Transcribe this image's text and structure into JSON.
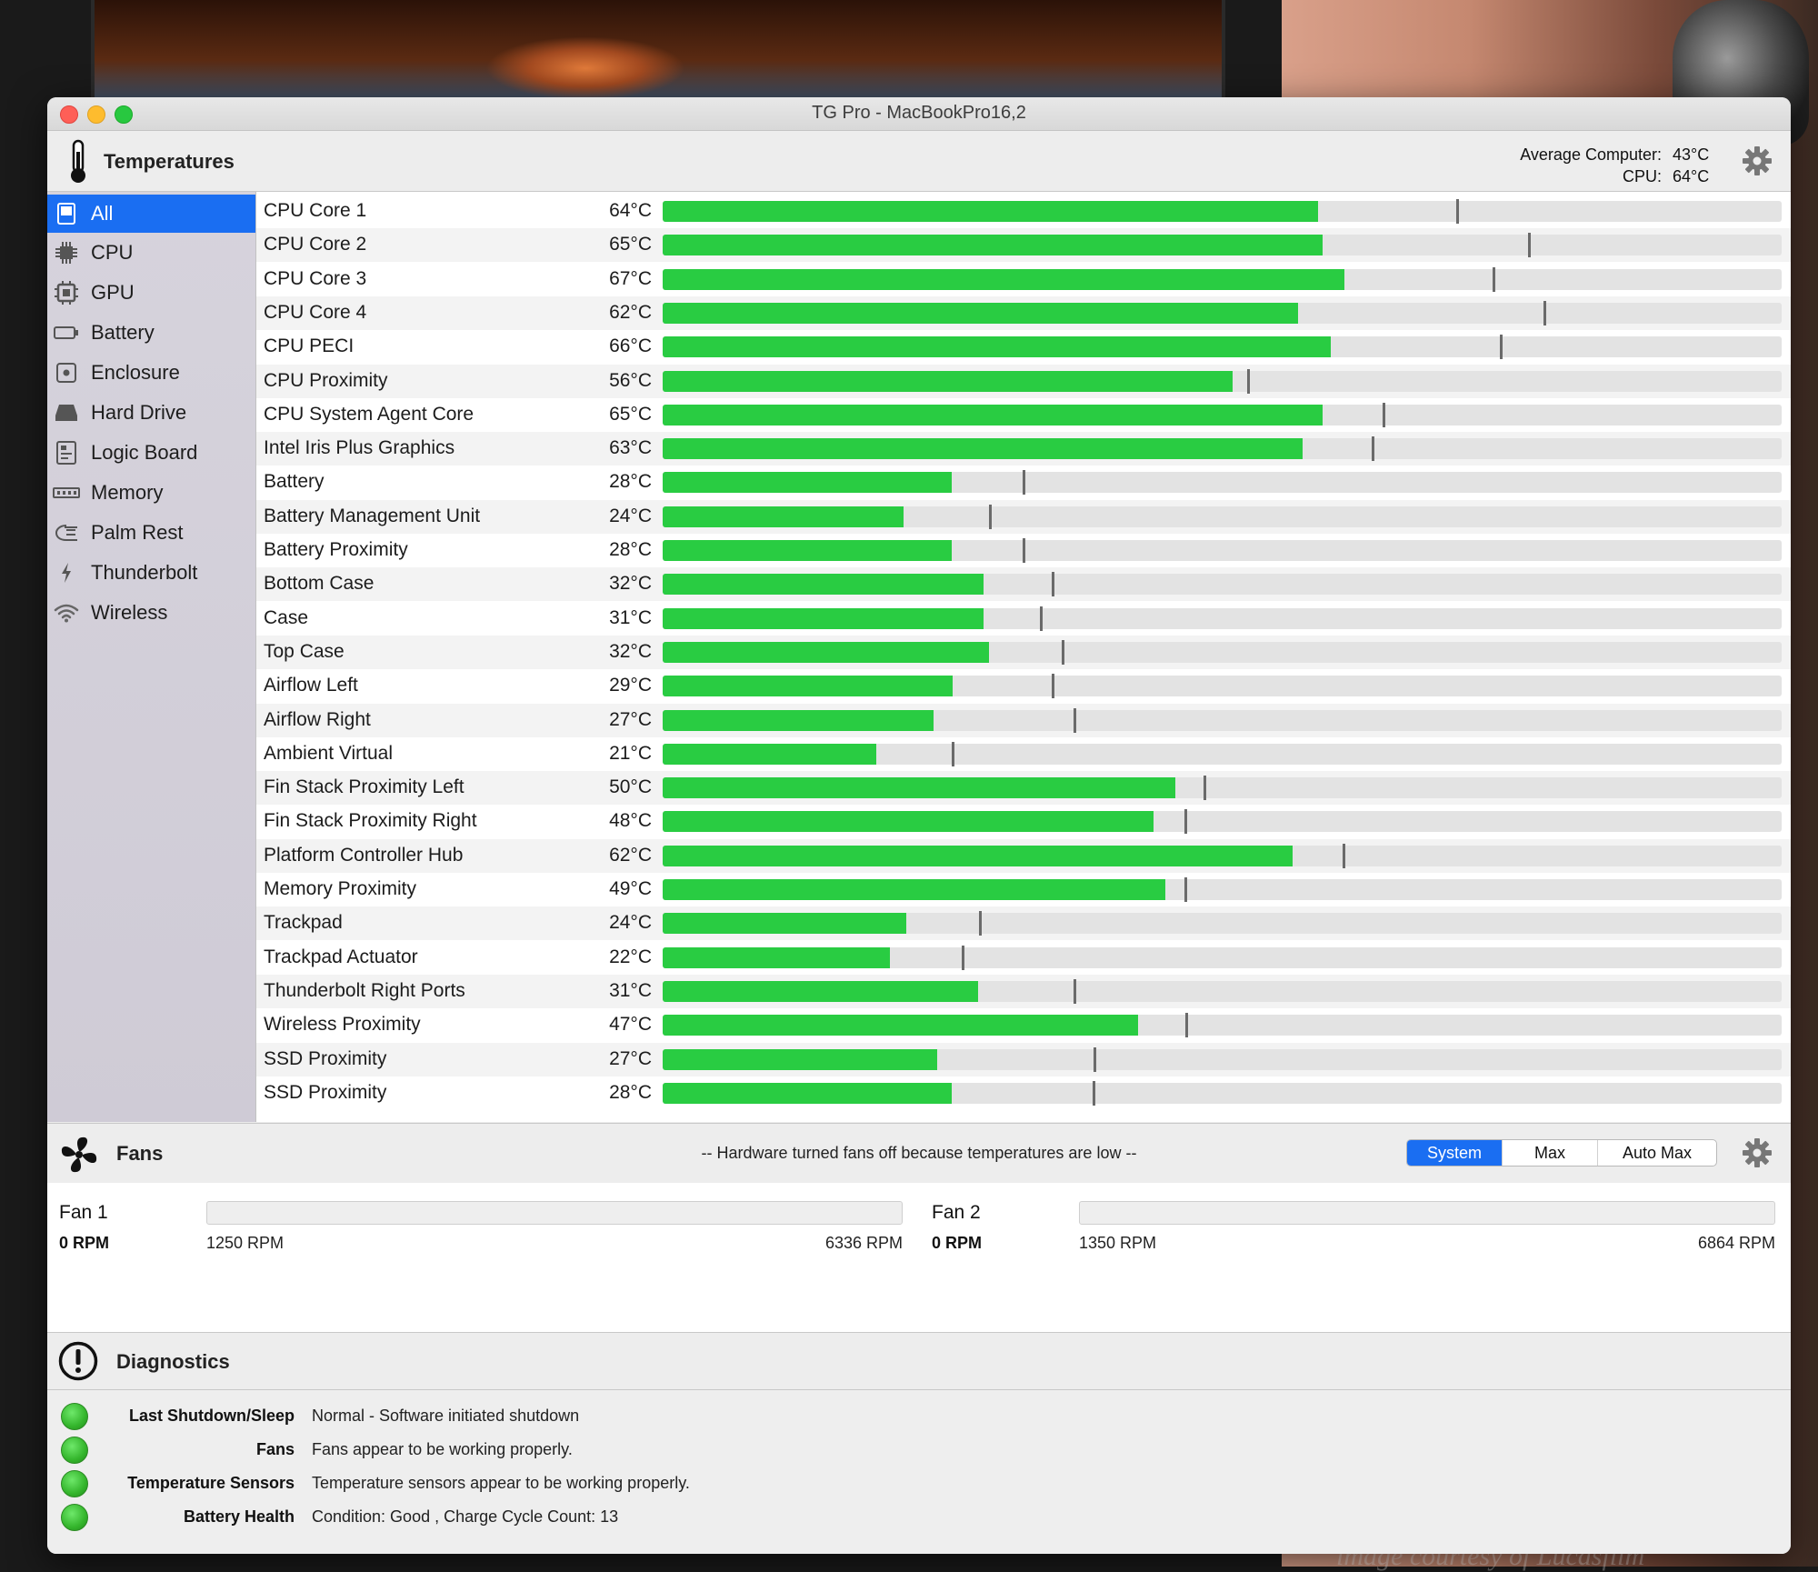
{
  "window": {
    "title": "TG Pro - MacBookPro16,2"
  },
  "temperatures": {
    "title": "Temperatures",
    "average_label": "Average Computer:",
    "average_value": "43°C",
    "cpu_label": "CPU:",
    "cpu_value": "64°C"
  },
  "sidebar": {
    "items": [
      {
        "label": "All",
        "icon": "all-icon",
        "active": true
      },
      {
        "label": "CPU",
        "icon": "cpu-icon"
      },
      {
        "label": "GPU",
        "icon": "gpu-icon"
      },
      {
        "label": "Battery",
        "icon": "battery-icon"
      },
      {
        "label": "Enclosure",
        "icon": "enclosure-icon"
      },
      {
        "label": "Hard Drive",
        "icon": "hard-drive-icon"
      },
      {
        "label": "Logic Board",
        "icon": "logic-board-icon"
      },
      {
        "label": "Memory",
        "icon": "memory-icon"
      },
      {
        "label": "Palm Rest",
        "icon": "palm-rest-icon"
      },
      {
        "label": "Thunderbolt",
        "icon": "thunderbolt-icon"
      },
      {
        "label": "Wireless",
        "icon": "wireless-icon"
      }
    ]
  },
  "sensors": [
    {
      "name": "CPU Core 1",
      "value": "64°C",
      "level": 0.586,
      "max_level": 0.709
    },
    {
      "name": "CPU Core 2",
      "value": "65°C",
      "level": 0.59,
      "max_level": 0.773
    },
    {
      "name": "CPU Core 3",
      "value": "67°C",
      "level": 0.609,
      "max_level": 0.742
    },
    {
      "name": "CPU Core 4",
      "value": "62°C",
      "level": 0.568,
      "max_level": 0.787
    },
    {
      "name": "CPU PECI",
      "value": "66°C",
      "level": 0.597,
      "max_level": 0.748
    },
    {
      "name": "CPU Proximity",
      "value": "56°C",
      "level": 0.509,
      "max_level": 0.522
    },
    {
      "name": "CPU System Agent Core",
      "value": "65°C",
      "level": 0.59,
      "max_level": 0.643
    },
    {
      "name": "Intel Iris Plus Graphics",
      "value": "63°C",
      "level": 0.572,
      "max_level": 0.634
    },
    {
      "name": "Battery",
      "value": "28°C",
      "level": 0.258,
      "max_level": 0.322
    },
    {
      "name": "Battery Management Unit",
      "value": "24°C",
      "level": 0.215,
      "max_level": 0.292
    },
    {
      "name": "Battery Proximity",
      "value": "28°C",
      "level": 0.258,
      "max_level": 0.322
    },
    {
      "name": "Bottom Case",
      "value": "32°C",
      "level": 0.287,
      "max_level": 0.348
    },
    {
      "name": "Case",
      "value": "31°C",
      "level": 0.287,
      "max_level": 0.337
    },
    {
      "name": "Top Case",
      "value": "32°C",
      "level": 0.292,
      "max_level": 0.357
    },
    {
      "name": "Airflow Left",
      "value": "29°C",
      "level": 0.259,
      "max_level": 0.348
    },
    {
      "name": "Airflow Right",
      "value": "27°C",
      "level": 0.242,
      "max_level": 0.367
    },
    {
      "name": "Ambient Virtual",
      "value": "21°C",
      "level": 0.191,
      "max_level": 0.258
    },
    {
      "name": "Fin Stack Proximity Left",
      "value": "50°C",
      "level": 0.458,
      "max_level": 0.483
    },
    {
      "name": "Fin Stack Proximity Right",
      "value": "48°C",
      "level": 0.439,
      "max_level": 0.466
    },
    {
      "name": "Platform Controller Hub",
      "value": "62°C",
      "level": 0.563,
      "max_level": 0.608
    },
    {
      "name": "Memory Proximity",
      "value": "49°C",
      "level": 0.449,
      "max_level": 0.466
    },
    {
      "name": "Trackpad",
      "value": "24°C",
      "level": 0.218,
      "max_level": 0.283
    },
    {
      "name": "Trackpad Actuator",
      "value": "22°C",
      "level": 0.203,
      "max_level": 0.267
    },
    {
      "name": "Thunderbolt Right Ports",
      "value": "31°C",
      "level": 0.282,
      "max_level": 0.367
    },
    {
      "name": "Wireless Proximity",
      "value": "47°C",
      "level": 0.425,
      "max_level": 0.467
    },
    {
      "name": "SSD Proximity",
      "value": "27°C",
      "level": 0.245,
      "max_level": 0.385
    },
    {
      "name": "SSD Proximity",
      "value": "28°C",
      "level": 0.258,
      "max_level": 0.384
    }
  ],
  "fans": {
    "title": "Fans",
    "message": "-- Hardware turned fans off because temperatures are low --",
    "modes": [
      "System",
      "Max",
      "Auto Max"
    ],
    "active_mode": "System",
    "items": [
      {
        "label": "Fan 1",
        "rpm": "0 RPM",
        "min": "1250 RPM",
        "max": "6336 RPM",
        "level": 0
      },
      {
        "label": "Fan 2",
        "rpm": "0 RPM",
        "min": "1350 RPM",
        "max": "6864 RPM",
        "level": 0
      }
    ]
  },
  "diagnostics": {
    "title": "Diagnostics",
    "items": [
      {
        "label": "Last Shutdown/Sleep",
        "text": "Normal - Software initiated shutdown",
        "status_color": "#34b52c"
      },
      {
        "label": "Fans",
        "text": "Fans appear to be working properly.",
        "status_color": "#34b52c"
      },
      {
        "label": "Temperature Sensors",
        "text": "Temperature sensors appear to be working properly.",
        "status_color": "#34b52c"
      },
      {
        "label": "Battery Health",
        "text": "Condition: Good , Charge Cycle Count: 13",
        "status_color": "#34b52c"
      }
    ]
  },
  "background": {
    "watermark": "image courtesy of Lucasfilm"
  },
  "colors": {
    "accent": "#1a6ef2",
    "bar_fill": "#29cc42",
    "bar_track": "#e3e3e3"
  }
}
